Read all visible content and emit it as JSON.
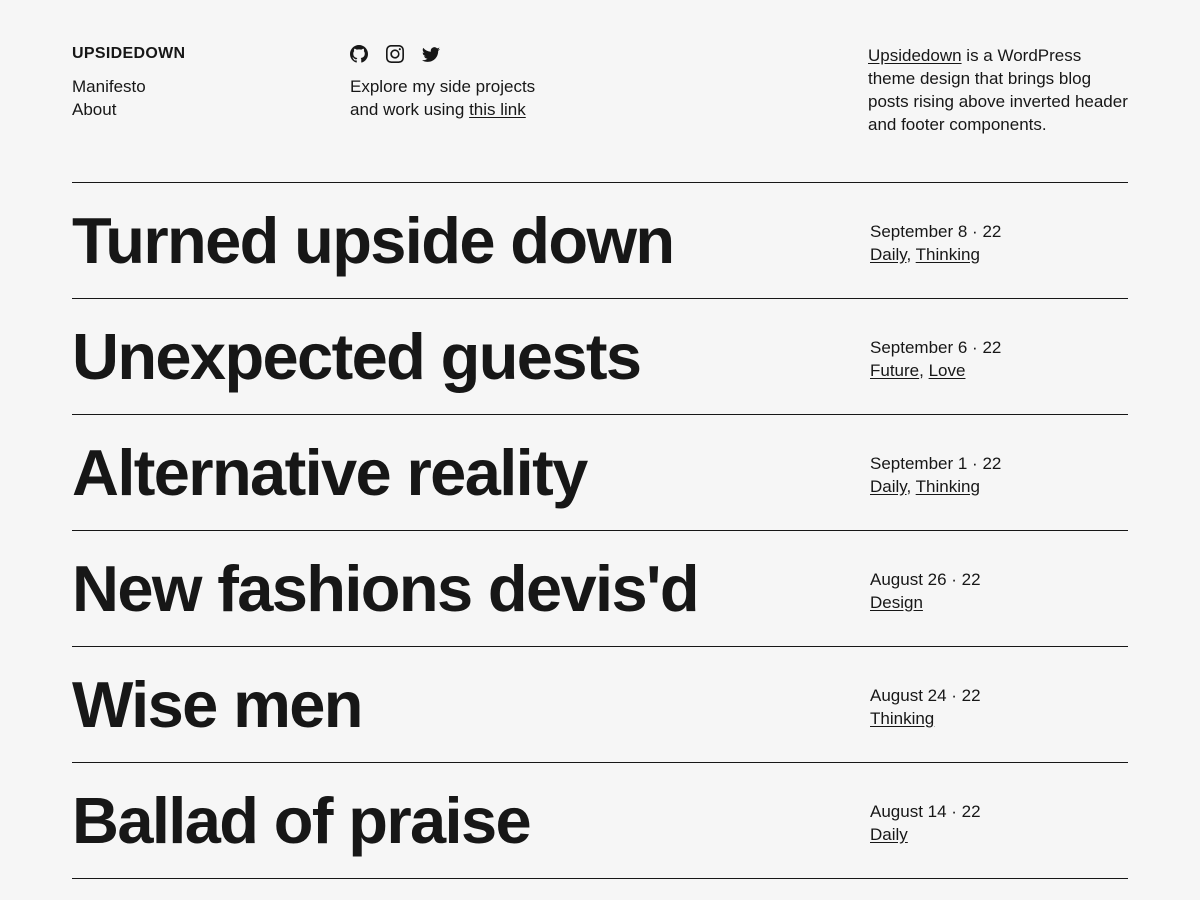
{
  "site": {
    "title": "UPSIDEDOWN",
    "nav": [
      {
        "label": "Manifesto"
      },
      {
        "label": "About"
      }
    ]
  },
  "explore": {
    "text_before": "Explore my side projects and work using ",
    "link_text": "this link"
  },
  "about": {
    "link": "Upsidedown",
    "rest": " is a WordPress theme design that brings blog posts rising above inverted header and footer components."
  },
  "posts": [
    {
      "title": "Turned upside down",
      "date": "September 8 · 22",
      "categories": [
        "Daily",
        "Thinking"
      ]
    },
    {
      "title": "Unexpected guests",
      "date": "September 6 · 22",
      "categories": [
        "Future",
        "Love"
      ]
    },
    {
      "title": "Alternative reality",
      "date": "September 1 · 22",
      "categories": [
        "Daily",
        "Thinking"
      ]
    },
    {
      "title": "New fashions devis'd",
      "date": "August 26 · 22",
      "categories": [
        "Design"
      ]
    },
    {
      "title": "Wise men",
      "date": "August 24 · 22",
      "categories": [
        "Thinking"
      ]
    },
    {
      "title": "Ballad of praise",
      "date": "August 14 · 22",
      "categories": [
        "Daily"
      ]
    }
  ]
}
